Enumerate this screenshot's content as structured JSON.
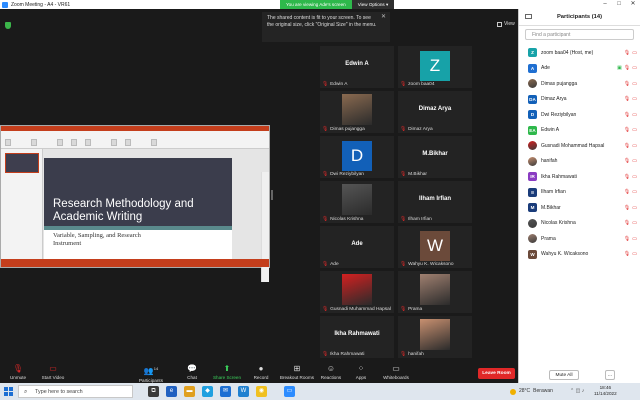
{
  "window": {
    "title": "Zoom Meeting - A4 - VR61",
    "banner_viewing": "You are viewing Ade's screen",
    "banner_options": "View Options",
    "view_label": "View"
  },
  "toast": {
    "message": "The shared content is fit to your screen. To see the original size, click \"Original Size\" in the menu."
  },
  "slide": {
    "title_line1": "Research Methodology and",
    "title_line2": "Academic Writing",
    "subtitle_line1": "Variable, Sampling, and Research",
    "subtitle_line2": "Instrument"
  },
  "tiles": [
    {
      "big": "Edwin A",
      "label": "Edwin A",
      "kind": "name"
    },
    {
      "big": "Z",
      "label": "zoom baa04",
      "kind": "avatar",
      "color": "#17a2a8"
    },
    {
      "big": "",
      "label": "Dimas pujangga",
      "kind": "photo",
      "color": "#8a6a50"
    },
    {
      "big": "Dimaz Arya",
      "label": "Dimaz Arya",
      "kind": "name"
    },
    {
      "big": "D",
      "label": "Dwi Reziybilyan",
      "kind": "avatar",
      "color": "#1260b8"
    },
    {
      "big": "M.Bikhar",
      "label": "M.Bikhar",
      "kind": "name"
    },
    {
      "big": "",
      "label": "Nicolas Krishna",
      "kind": "photo",
      "color": "#555555"
    },
    {
      "big": "Ilham Irfian",
      "label": "Ilham Irfian",
      "kind": "name"
    },
    {
      "big": "Ade",
      "label": "Ade",
      "kind": "name"
    },
    {
      "big": "W",
      "label": "Wahyu K. Wicaksono",
      "kind": "avatar",
      "color": "#6b4a3a"
    },
    {
      "big": "",
      "label": "Gusnadi Muhammad Hapsal",
      "kind": "photo",
      "color": "#d42020"
    },
    {
      "big": "",
      "label": "Prama",
      "kind": "photo",
      "color": "#a08070"
    },
    {
      "big": "Ikha Rahmawati",
      "label": "Ikha Rahmawati",
      "kind": "name"
    },
    {
      "big": "",
      "label": "hanifah",
      "kind": "photo",
      "color": "#c89070"
    }
  ],
  "toolbar": {
    "unmute": "Unmute",
    "start_video": "Start Video",
    "participants": "Participants",
    "participants_count": "14",
    "chat": "Chat",
    "share_screen": "Share Screen",
    "record": "Record",
    "breakout": "Breakout Rooms",
    "reactions": "Reactions",
    "apps": "Apps",
    "whiteboards": "Whiteboards",
    "leave": "Leave Room"
  },
  "panel": {
    "header": "Participants (14)",
    "search_placeholder": "Find a participant",
    "mute_all": "Mute All",
    "more": "...",
    "participants": [
      {
        "initial": "Z",
        "name": "zoom baa04 (Host, me)",
        "color": "#17a2a8",
        "photo": false
      },
      {
        "initial": "A",
        "name": "Ade",
        "color": "#1f6fd1",
        "photo": false,
        "sharing": true
      },
      {
        "initial": "",
        "name": "Dimas pujangga",
        "color": "#8a6a50",
        "photo": true
      },
      {
        "initial": "DA",
        "name": "Dimaz Arya",
        "color": "#1260b8",
        "photo": false
      },
      {
        "initial": "D",
        "name": "Dwi Reziybilyan",
        "color": "#1260b8",
        "photo": false
      },
      {
        "initial": "EA",
        "name": "Edwin A",
        "color": "#2eb84b",
        "photo": false
      },
      {
        "initial": "",
        "name": "Gusnadi Mohammad Hapsal",
        "color": "#d42020",
        "photo": true
      },
      {
        "initial": "",
        "name": "hanifah",
        "color": "#c89070",
        "photo": true
      },
      {
        "initial": "IR",
        "name": "Ikha Rahmawati",
        "color": "#8a3cc2",
        "photo": false
      },
      {
        "initial": "II",
        "name": "Ilham Irfian",
        "color": "#1a3c7a",
        "photo": false
      },
      {
        "initial": "M",
        "name": "M.Bikhar",
        "color": "#1a3c7a",
        "photo": false
      },
      {
        "initial": "",
        "name": "Nicolas Krishna",
        "color": "#555555",
        "photo": true
      },
      {
        "initial": "",
        "name": "Prama",
        "color": "#a08070",
        "photo": true
      },
      {
        "initial": "W",
        "name": "Wahyu K. Wicaksono",
        "color": "#6b4a3a",
        "photo": false
      }
    ]
  },
  "taskbar": {
    "search": "Type here to search",
    "temperature": "28°C",
    "weather": "Berawan",
    "time": "18:46",
    "date": "11/14/2022"
  }
}
